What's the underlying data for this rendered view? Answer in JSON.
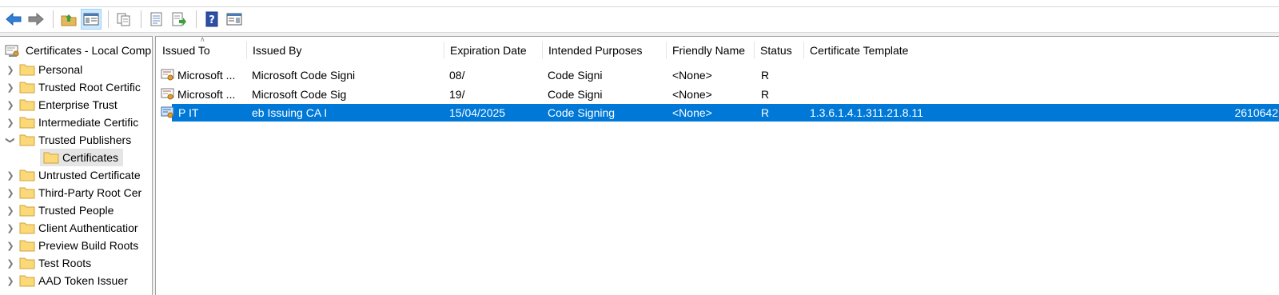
{
  "toolbar": {
    "buttons": [
      {
        "icon": "back-arrow-icon"
      },
      {
        "icon": "forward-arrow-icon"
      },
      {
        "icon": "up-folder-icon"
      },
      {
        "icon": "show-hide-console-tree-icon",
        "active": true
      },
      {
        "icon": "copy-icon"
      },
      {
        "icon": "properties-icon"
      },
      {
        "icon": "export-list-icon"
      },
      {
        "icon": "help-icon"
      },
      {
        "icon": "show-hide-action-pane-icon"
      }
    ]
  },
  "tree": {
    "root_label": "Certificates - Local Comp",
    "items": [
      {
        "label": "Personal",
        "expanded": false
      },
      {
        "label": "Trusted Root Certific",
        "expanded": false
      },
      {
        "label": "Enterprise Trust",
        "expanded": false
      },
      {
        "label": "Intermediate Certific",
        "expanded": false
      },
      {
        "label": "Trusted Publishers",
        "expanded": true
      },
      {
        "label": "Certificates",
        "child": true,
        "selected": true
      },
      {
        "label": "Untrusted Certificate",
        "expanded": false
      },
      {
        "label": "Third-Party Root Cer",
        "expanded": false
      },
      {
        "label": "Trusted People",
        "expanded": false
      },
      {
        "label": "Client Authenticatior",
        "expanded": false
      },
      {
        "label": "Preview Build Roots",
        "expanded": false
      },
      {
        "label": "Test Roots",
        "expanded": false
      },
      {
        "label": "AAD Token Issuer",
        "expanded": false
      }
    ]
  },
  "list": {
    "columns": [
      "Issued To",
      "Issued By",
      "Expiration Date",
      "Intended Purposes",
      "Friendly Name",
      "Status",
      "Certificate Template"
    ],
    "rows": [
      {
        "issued_to": "Microsoft ...",
        "issued_by": "Microsoft Code Signi",
        "expiration": "08/",
        "purposes": "Code Signi",
        "friendly": "<None>",
        "status": "R",
        "template": "",
        "selected": false
      },
      {
        "issued_to": "Microsoft ...",
        "issued_by": "Microsoft Code Sig",
        "expiration": "19/",
        "purposes": "Code Signi",
        "friendly": "<None>",
        "status": "R",
        "template": "",
        "selected": false
      },
      {
        "issued_to": "P IT",
        "issued_by": "eb Issuing CA I",
        "expiration": "15/04/2025",
        "purposes": "Code Signing",
        "friendly": "<None>",
        "status": "R",
        "template": "1.3.6.1.4.1.311.21.8.11",
        "template_end": "2610642",
        "selected": true
      }
    ]
  },
  "colors": {
    "selection": "#0078d7",
    "selected_node": "#e5e5e5",
    "toolbar_active": "#cce8ff"
  }
}
